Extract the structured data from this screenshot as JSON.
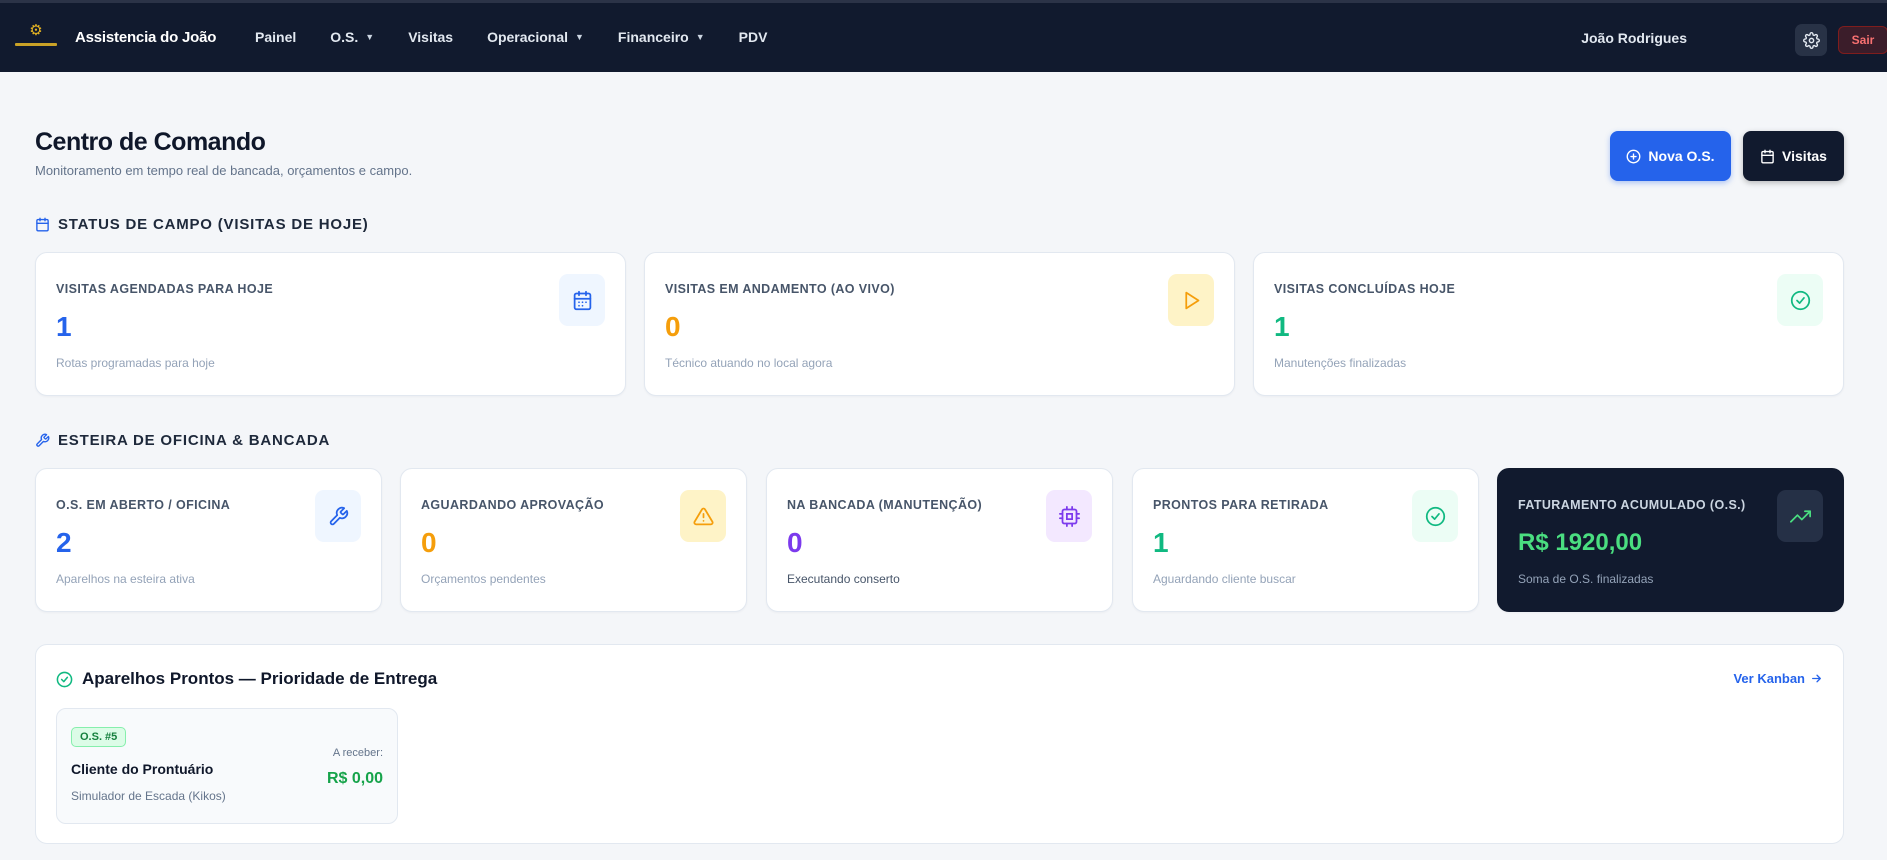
{
  "header": {
    "brand": "Assistencia do João",
    "nav": [
      {
        "label": "Painel",
        "dropdown": false
      },
      {
        "label": "O.S.",
        "dropdown": true
      },
      {
        "label": "Visitas",
        "dropdown": false
      },
      {
        "label": "Operacional",
        "dropdown": true
      },
      {
        "label": "Financeiro",
        "dropdown": true
      },
      {
        "label": "PDV",
        "dropdown": false
      }
    ],
    "user_name": "João Rodrigues",
    "logout_label": "Sair"
  },
  "page": {
    "title": "Centro de Comando",
    "subtitle": "Monitoramento em tempo real de bancada, orçamentos e campo.",
    "btn_new_os": "Nova O.S.",
    "btn_visits": "Visitas"
  },
  "campo": {
    "title": "STATUS DE CAMPO (VISITAS DE HOJE)",
    "cards": [
      {
        "label": "VISITAS AGENDADAS PARA HOJE",
        "value": "1",
        "desc": "Rotas programadas para hoje",
        "color": "#2563eb",
        "icon": "calendar-icon"
      },
      {
        "label": "VISITAS EM ANDAMENTO (AO VIVO)",
        "value": "0",
        "desc": "Técnico atuando no local agora",
        "color": "#f59e0b",
        "icon": "play-icon"
      },
      {
        "label": "VISITAS CONCLUÍDAS HOJE",
        "value": "1",
        "desc": "Manutenções finalizadas",
        "color": "#10b981",
        "icon": "check-circle-icon"
      }
    ]
  },
  "oficina": {
    "title": "ESTEIRA DE OFICINA & BANCADA",
    "cards": [
      {
        "label": "O.S. EM ABERTO / OFICINA",
        "value": "2",
        "desc": "Aparelhos na esteira ativa",
        "color": "#2563eb",
        "icon": "wrench-icon"
      },
      {
        "label": "AGUARDANDO APROVAÇÃO",
        "value": "0",
        "desc": "Orçamentos pendentes",
        "color": "#f59e0b",
        "icon": "alert-triangle-icon"
      },
      {
        "label": "NA BANCADA (MANUTENÇÃO)",
        "value": "0",
        "desc": "Executando conserto",
        "color": "#7c3aed",
        "icon": "cpu-icon"
      },
      {
        "label": "PRONTOS PARA RETIRADA",
        "value": "1",
        "desc": "Aguardando cliente buscar",
        "color": "#10b981",
        "icon": "check-circle-icon"
      },
      {
        "label": "FATURAMENTO ACUMULADO (O.S.)",
        "value": "R$ 1920,00",
        "desc": "Soma de O.S. finalizadas",
        "color": "#4ade80",
        "icon": "trending-up-icon"
      }
    ]
  },
  "prontos": {
    "title": "Aparelhos Prontos — Prioridade de Entrega",
    "link": "Ver Kanban",
    "items": [
      {
        "badge": "O.S. #5",
        "client": "Cliente do Prontuário",
        "product": "Simulador de Escada (Kikos)",
        "receber_label": "A receber:",
        "receber_value": "R$ 0,00"
      }
    ]
  }
}
